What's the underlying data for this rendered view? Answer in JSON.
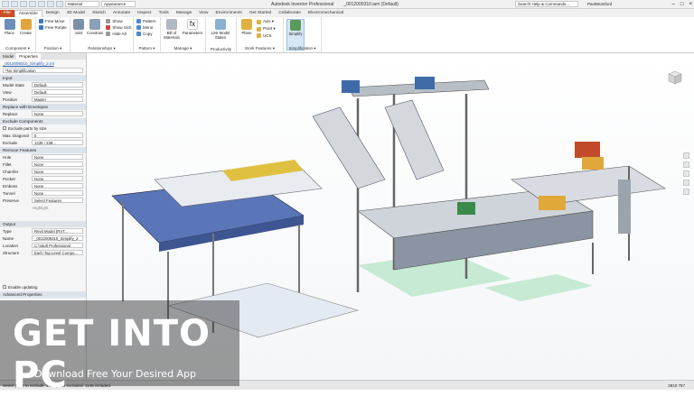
{
  "titlebar": {
    "material": "Material",
    "appearance": "Appearance",
    "app_title": "Autodesk Inventor Professional",
    "doc_title": "_0012009310.iam (Default)",
    "search_placeholder": "Search Help & Commands...",
    "user": "PaulWumford"
  },
  "tabs": [
    "File",
    "Assemble",
    "Design",
    "3D Model",
    "Sketch",
    "Annotate",
    "Inspect",
    "Tools",
    "Manage",
    "View",
    "Environments",
    "Get Started",
    "Collaborate",
    "Electromechanical"
  ],
  "ribbon": {
    "component": {
      "label": "Component ▾",
      "place": "Place",
      "create": "Create"
    },
    "position": {
      "label": "Position ▾",
      "free_move": "Free Move",
      "free_rotate": "Free Rotate"
    },
    "relationships": {
      "label": "Relationships ▾",
      "joint": "Joint",
      "constrain": "Constrain",
      "show": "Show",
      "show_sick": "Show Sick",
      "hide_all": "Hide All"
    },
    "pattern": {
      "label": "Pattern ▾",
      "pattern": "Pattern",
      "mirror": "Mirror",
      "copy": "Copy"
    },
    "manage": {
      "label": "Manage ▾",
      "bom": "Bill of Materials",
      "parameters": "Parameters"
    },
    "productivity": {
      "label": "Productivity",
      "link_model_states": "Link Model States"
    },
    "work_features": {
      "label": "Work Features ▾",
      "plane": "Plane",
      "axis": "Axis ▾",
      "point": "Point ▾",
      "ucs": "UCS"
    },
    "simplification": {
      "label": "Simplification ▾",
      "simplify": "Simplify"
    }
  },
  "panel": {
    "tabs": [
      "Model",
      "Properties"
    ],
    "file_link": "_0012009310_Simplify_2.ml",
    "simplification": "*No Simplification",
    "input_head": "Input",
    "model_state": {
      "label": "Model State",
      "value": "Default"
    },
    "view": {
      "label": "View",
      "value": "Default"
    },
    "position": {
      "label": "Position",
      "value": "Master"
    },
    "replace_head": "Replace with Envelopes",
    "replace": {
      "label": "Replace",
      "value": "None"
    },
    "exclude_head": "Exclude Components",
    "exclude_by_size": "Exclude parts by size",
    "max_diagonal": {
      "label": "Max. Diagonal",
      "value": "5"
    },
    "exclude": {
      "label": "Exclude",
      "value": "1435 / 238..."
    },
    "remove_head": "Remove Features",
    "hole": {
      "label": "Hole",
      "value": "None"
    },
    "fillet": {
      "label": "Fillet",
      "value": "None"
    },
    "chamfer": {
      "label": "Chamfer",
      "value": "None"
    },
    "pocket": {
      "label": "Pocket",
      "value": "None"
    },
    "emboss": {
      "label": "Emboss",
      "value": "None"
    },
    "tunnel": {
      "label": "Tunnel",
      "value": "None"
    },
    "preserve": {
      "label": "Preserve",
      "value": "Select Features"
    },
    "highlight": "Highlight",
    "output_head": "Output",
    "type": {
      "label": "Type",
      "value": "Revit Model (RVT..."
    },
    "name": {
      "label": "Name",
      "value": "_0012009310_Simplify_2"
    },
    "location": {
      "label": "Location",
      "value": "C:\\Vault Professional"
    },
    "structure": {
      "label": "Structure",
      "value": "Each Top Level Compo..."
    },
    "enable_updating": "Enable updating",
    "advanced_head": "Advanced Properties"
  },
  "status": {
    "text": "Select parts to exclude. 1435 parts excluded. 1145 included.",
    "counts": "2910    757"
  },
  "watermark": {
    "big": "GET INTO PC",
    "small": "Download Free Your Desired App"
  }
}
